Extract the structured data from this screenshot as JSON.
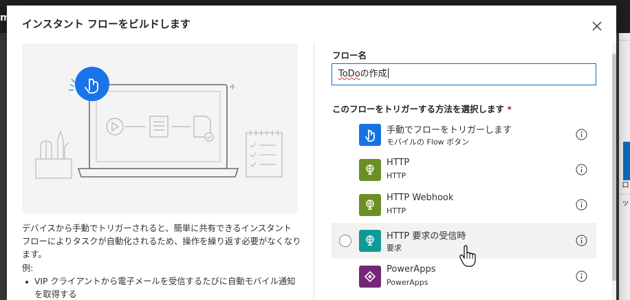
{
  "background": {
    "app_letter": "m",
    "right_texts": [
      "ロ",
      "ッ"
    ]
  },
  "dialog": {
    "title": "インスタント フローをビルドします",
    "description": "デバイスから手動でトリガーされると、簡単に共有できるインスタント フローによりタスクが自動化されるため、操作を繰り返す必要がなくなります。",
    "example_label": "例:",
    "example_items": [
      "VIP クライアントから電子メールを受信するたびに自動モバイル通知を取得する"
    ]
  },
  "form": {
    "flow_name_label": "フロー名",
    "flow_name_value_part1": "ToDo",
    "flow_name_value_part2": "の作成",
    "trigger_label": "このフローをトリガーする方法を選択します",
    "required_mark": "*"
  },
  "triggers": [
    {
      "name": "手動でフローをトリガーします",
      "sub": "モバイルの Flow ボタン",
      "color": "#1673e6",
      "icon": "touch-icon"
    },
    {
      "name": "HTTP",
      "sub": "HTTP",
      "color": "#6b8f23",
      "icon": "globe-icon"
    },
    {
      "name": "HTTP Webhook",
      "sub": "HTTP",
      "color": "#6b8f23",
      "icon": "globe-icon"
    },
    {
      "name": "HTTP 要求の受信時",
      "sub": "要求",
      "color": "#0e9b96",
      "icon": "globe-icon"
    },
    {
      "name": "PowerApps",
      "sub": "PowerApps",
      "color": "#742774",
      "icon": "powerapps-icon"
    }
  ],
  "colors": {
    "accent": "#0f6cbd",
    "hero_bg": "#f4f4f4",
    "hover_bg": "#f3f2f1"
  }
}
